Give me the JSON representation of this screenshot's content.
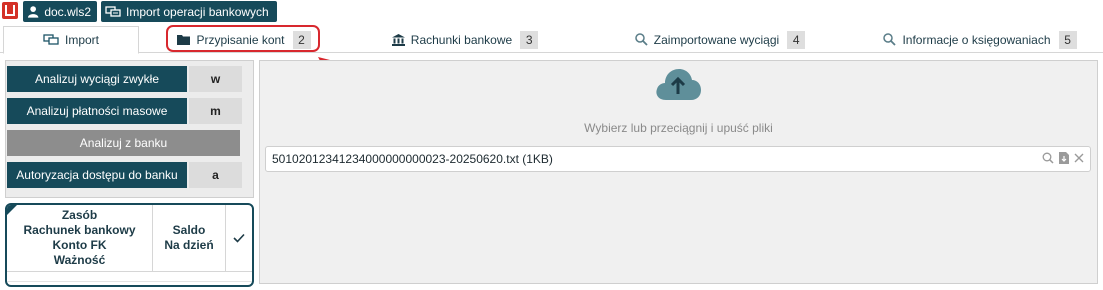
{
  "topbar": {
    "doc_label": "doc.wls2",
    "import_label": "Import operacji bankowych"
  },
  "tabs": [
    {
      "label": "Import",
      "badge": ""
    },
    {
      "label": "Przypisanie kont",
      "badge": "2"
    },
    {
      "label": "Rachunki bankowe",
      "badge": "3"
    },
    {
      "label": "Zaimportowane wyciągi",
      "badge": "4"
    },
    {
      "label": "Informacje o księgowaniach",
      "badge": "5"
    }
  ],
  "actions": {
    "analizuj_zwykle": "Analizuj wyciągi zwykłe",
    "analizuj_zwykle_key": "w",
    "analizuj_masowe": "Analizuj płatności masowe",
    "analizuj_masowe_key": "m",
    "analizuj_z_banku": "Analizuj z banku",
    "autoryzacja": "Autoryzacja dostępu do banku",
    "autoryzacja_key": "a"
  },
  "accounts_table": {
    "col1": [
      "Zasób",
      "Rachunek bankowy",
      "Konto FK",
      "Ważność"
    ],
    "col2": [
      "Saldo",
      "Na dzień"
    ],
    "col3_icon": "check-icon"
  },
  "upload": {
    "hint": "Wybierz lub przeciągnij i upuść pliki",
    "file_value": "50102012341234000000000023-20250620.txt (1KB)"
  },
  "colors": {
    "brand_dark": "#164a5a",
    "accent_red": "#d8282e",
    "logo_red": "#d43127",
    "cloud": "#5f8f9a"
  }
}
